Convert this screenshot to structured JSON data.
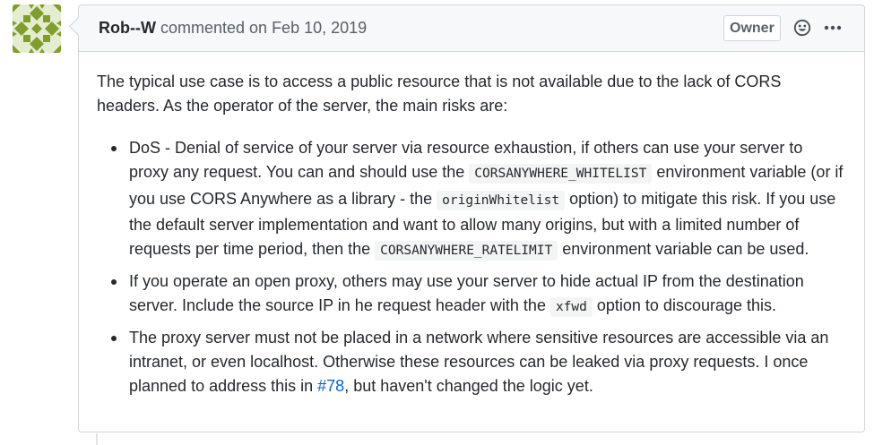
{
  "comment": {
    "author": "Rob--W",
    "action": "commented on",
    "date": "Feb 10, 2019",
    "badge": "Owner",
    "intro": "The typical use case is to access a public resource that is not available due to the lack of CORS headers. As the operator of the server, the main risks are:",
    "items": [
      {
        "t1": "DoS - Denial of service of your server via resource exhaustion, if others can use your server to proxy any request. You can and should use the ",
        "c1": "CORSANYWHERE_WHITELIST",
        "t2": " environment variable (or if you use CORS Anywhere as a library - the ",
        "c2": "originWhitelist",
        "t3": " option) to mitigate this risk. If you use the default server implementation and want to allow many origins, but with a limited number of requests per time period, then the ",
        "c3": "CORSANYWHERE_RATELIMIT",
        "t4": " environment variable can be used."
      },
      {
        "t1": "If you operate an open proxy, others may use your server to hide actual IP from the destination server. Include the source IP in he request header with the ",
        "c1": "xfwd",
        "t2": " option to discourage this."
      },
      {
        "t1": "The proxy server must not be placed in a network where sensitive resources are accessible via an intranet, or even localhost. Otherwise these resources can be leaked via proxy requests. I once planned to address this in ",
        "link": "#78",
        "t2": ", but haven't changed the logic yet."
      }
    ]
  },
  "icons": {
    "avatar": "identicon-avatar",
    "reaction": "smiley-icon",
    "more": "kebab-horizontal-icon"
  },
  "colors": {
    "avatar_fg": "#7f9e2b",
    "link": "#0366d6",
    "header_bg": "#f6f8fa",
    "border": "#d1d5da"
  }
}
